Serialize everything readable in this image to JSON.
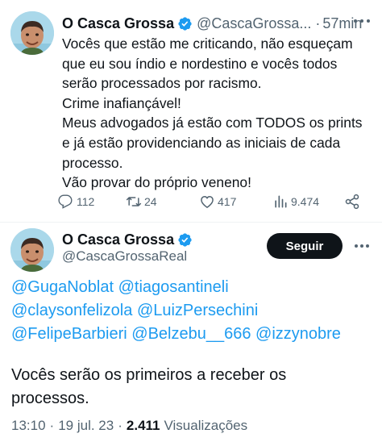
{
  "tweet": {
    "author": {
      "display_name": "O Casca Grossa",
      "handle": "@CascaGrossa...",
      "verified_icon": "verified-badge-icon"
    },
    "separator": "·",
    "time": "57min",
    "text_lines": [
      "Vocês que estão me criticando, não esqueçam",
      "que eu sou índio e nordestino e vocês todos",
      "serão processados por racismo.",
      "Crime inafiançável!",
      "Meus advogados já estão com TODOS os prints",
      "e já estão providenciando as iniciais de cada",
      "processo.",
      "Vão provar do próprio veneno!"
    ],
    "actions": {
      "replies": "112",
      "retweets": "24",
      "likes": "417",
      "views": "9.474"
    }
  },
  "reply": {
    "author": {
      "display_name": "O Casca Grossa",
      "handle": "@CascaGrossaReal"
    },
    "follow_label": "Seguir",
    "mentions": [
      [
        "@GugaNoblat",
        "@tiagosantineli"
      ],
      [
        "@claysonfelizola",
        "@LuizPersechini"
      ],
      [
        "@FelipeBarbieri",
        "@Belzebu__666",
        "@izzynobre"
      ]
    ],
    "text_lines": [
      "Vocês serão os primeiros a receber os",
      "processos."
    ],
    "meta": {
      "time": "13:10",
      "separator": "·",
      "date": "19 jul. 23",
      "views_count": "2.411",
      "views_label": "Visualizações"
    }
  },
  "colors": {
    "accent": "#1d9bf0",
    "text": "#0f1419",
    "secondary": "#536471",
    "follow_bg": "#0f1419"
  }
}
